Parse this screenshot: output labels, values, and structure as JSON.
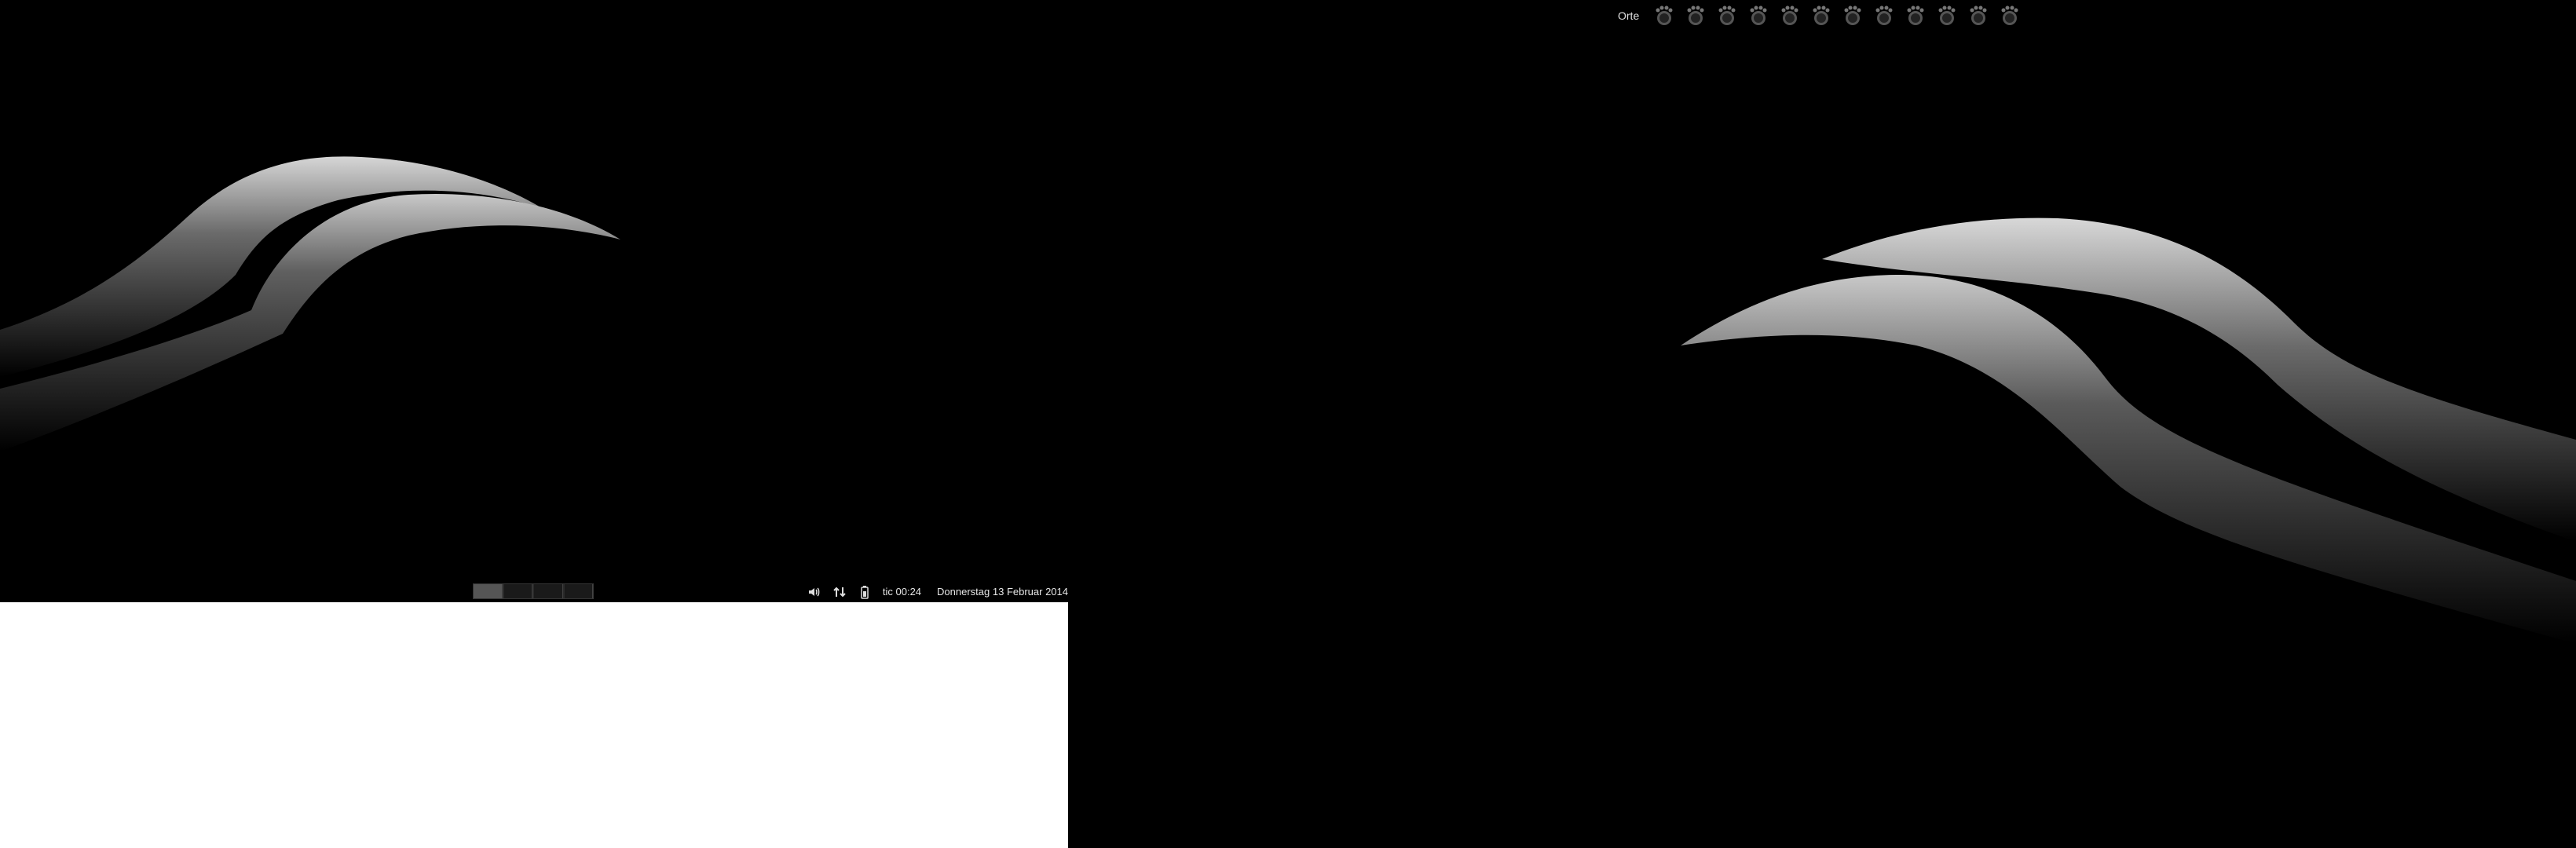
{
  "desktop": {
    "background_color": "#000000",
    "blank_area_color": "#ffffff"
  },
  "left_panel": {
    "pager": {
      "desktops": 4,
      "active_index": 0
    },
    "tray": {
      "volume_icon": "speaker-icon",
      "network_icon": "network-arrows-icon",
      "battery_icon": "battery-icon",
      "timer_text": "tic 00:24",
      "date_text": "Donnerstag 13 Februar 2014"
    }
  },
  "right_panel": {
    "places_label": "Orte",
    "launchers": [
      {
        "icon": "gnome-foot-icon"
      },
      {
        "icon": "gnome-foot-icon"
      },
      {
        "icon": "gnome-foot-icon"
      },
      {
        "icon": "gnome-foot-icon"
      },
      {
        "icon": "gnome-foot-icon"
      },
      {
        "icon": "gnome-foot-icon"
      },
      {
        "icon": "gnome-foot-icon"
      },
      {
        "icon": "gnome-foot-icon"
      },
      {
        "icon": "gnome-foot-icon"
      },
      {
        "icon": "gnome-foot-icon"
      },
      {
        "icon": "gnome-foot-icon"
      },
      {
        "icon": "gnome-foot-icon"
      }
    ]
  }
}
